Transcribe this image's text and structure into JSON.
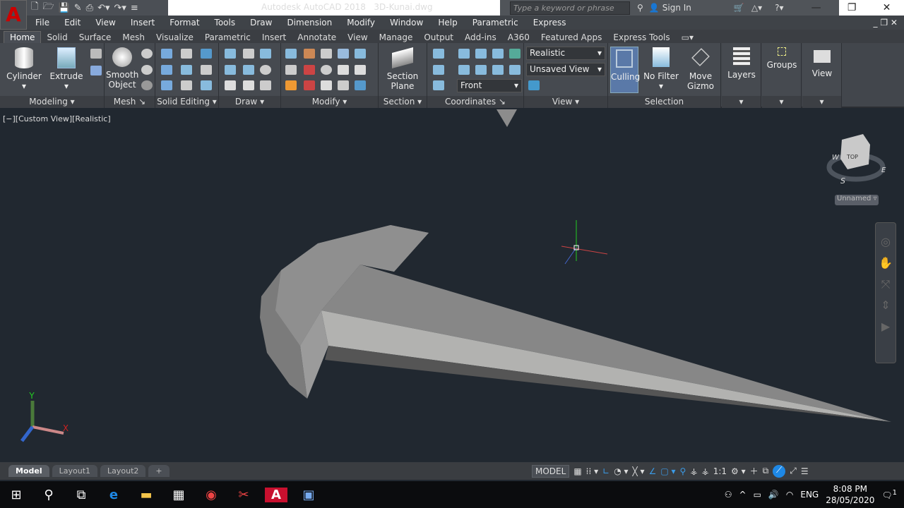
{
  "app": {
    "title": "Autodesk AutoCAD 2018",
    "file": "3D-Kunai.dwg",
    "logo": "A"
  },
  "search": {
    "placeholder": "Type a keyword or phrase"
  },
  "account": {
    "sign_in": "Sign In"
  },
  "menu": [
    "File",
    "Edit",
    "View",
    "Insert",
    "Format",
    "Tools",
    "Draw",
    "Dimension",
    "Modify",
    "Window",
    "Help",
    "Parametric",
    "Express"
  ],
  "tabs": [
    "Home",
    "Solid",
    "Surface",
    "Mesh",
    "Visualize",
    "Parametric",
    "Insert",
    "Annotate",
    "View",
    "Manage",
    "Output",
    "Add-ins",
    "A360",
    "Featured Apps",
    "Express Tools"
  ],
  "ribbon": {
    "panels": [
      "Modeling ▾",
      "Mesh ↘",
      "Solid Editing ▾",
      "Draw ▾",
      "Modify ▾",
      "Section ▾ ↘",
      "Coordinates ↘",
      "View ▾",
      "Selection"
    ],
    "cylinder": "Cylinder",
    "extrude": "Extrude",
    "smooth": "Smooth",
    "object": "Object",
    "section": "Section",
    "plane": "Plane",
    "visual_style": "Realistic",
    "named_view": "Unsaved View",
    "ucs_view": "Front",
    "culling": "Culling",
    "no_filter": "No Filter",
    "move": "Move",
    "gizmo": "Gizmo",
    "layers": "Layers",
    "groups": "Groups",
    "view": "View"
  },
  "viewport": {
    "label": "[−][Custom View][Realistic]",
    "viewcube_face": "TOP",
    "compass": [
      "W",
      "E",
      "S"
    ],
    "ucs_name": "Unnamed",
    "axes": {
      "x": "X",
      "y": "Y"
    }
  },
  "layout_tabs": [
    "Model",
    "Layout1",
    "Layout2",
    "+"
  ],
  "status": {
    "model": "MODEL",
    "scale": "1:1"
  },
  "tray": {
    "lang": "ENG",
    "time": "8:08 PM",
    "date": "28/05/2020",
    "notifications": "1"
  },
  "colors": {
    "viewport": "#212830",
    "accent": "#1e88e5",
    "autocad_red": "#c8102e"
  }
}
